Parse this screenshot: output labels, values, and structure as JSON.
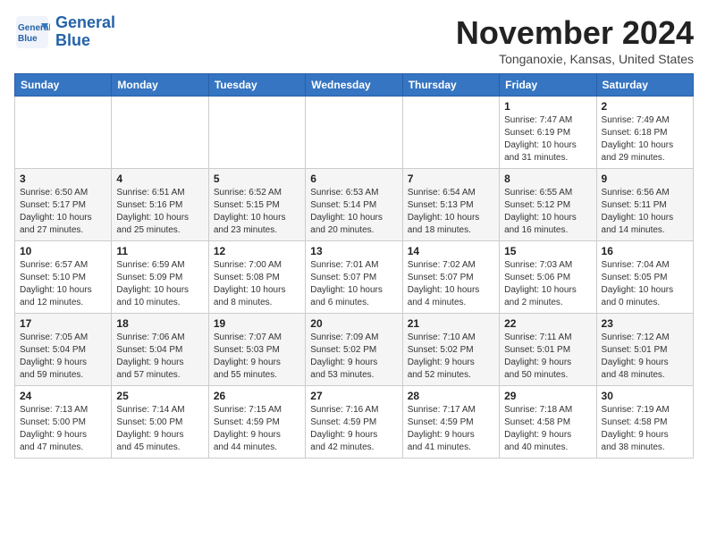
{
  "header": {
    "logo_line1": "General",
    "logo_line2": "Blue",
    "month": "November 2024",
    "location": "Tonganoxie, Kansas, United States"
  },
  "weekdays": [
    "Sunday",
    "Monday",
    "Tuesday",
    "Wednesday",
    "Thursday",
    "Friday",
    "Saturday"
  ],
  "weeks": [
    [
      {
        "day": "",
        "info": ""
      },
      {
        "day": "",
        "info": ""
      },
      {
        "day": "",
        "info": ""
      },
      {
        "day": "",
        "info": ""
      },
      {
        "day": "",
        "info": ""
      },
      {
        "day": "1",
        "info": "Sunrise: 7:47 AM\nSunset: 6:19 PM\nDaylight: 10 hours\nand 31 minutes."
      },
      {
        "day": "2",
        "info": "Sunrise: 7:49 AM\nSunset: 6:18 PM\nDaylight: 10 hours\nand 29 minutes."
      }
    ],
    [
      {
        "day": "3",
        "info": "Sunrise: 6:50 AM\nSunset: 5:17 PM\nDaylight: 10 hours\nand 27 minutes."
      },
      {
        "day": "4",
        "info": "Sunrise: 6:51 AM\nSunset: 5:16 PM\nDaylight: 10 hours\nand 25 minutes."
      },
      {
        "day": "5",
        "info": "Sunrise: 6:52 AM\nSunset: 5:15 PM\nDaylight: 10 hours\nand 23 minutes."
      },
      {
        "day": "6",
        "info": "Sunrise: 6:53 AM\nSunset: 5:14 PM\nDaylight: 10 hours\nand 20 minutes."
      },
      {
        "day": "7",
        "info": "Sunrise: 6:54 AM\nSunset: 5:13 PM\nDaylight: 10 hours\nand 18 minutes."
      },
      {
        "day": "8",
        "info": "Sunrise: 6:55 AM\nSunset: 5:12 PM\nDaylight: 10 hours\nand 16 minutes."
      },
      {
        "day": "9",
        "info": "Sunrise: 6:56 AM\nSunset: 5:11 PM\nDaylight: 10 hours\nand 14 minutes."
      }
    ],
    [
      {
        "day": "10",
        "info": "Sunrise: 6:57 AM\nSunset: 5:10 PM\nDaylight: 10 hours\nand 12 minutes."
      },
      {
        "day": "11",
        "info": "Sunrise: 6:59 AM\nSunset: 5:09 PM\nDaylight: 10 hours\nand 10 minutes."
      },
      {
        "day": "12",
        "info": "Sunrise: 7:00 AM\nSunset: 5:08 PM\nDaylight: 10 hours\nand 8 minutes."
      },
      {
        "day": "13",
        "info": "Sunrise: 7:01 AM\nSunset: 5:07 PM\nDaylight: 10 hours\nand 6 minutes."
      },
      {
        "day": "14",
        "info": "Sunrise: 7:02 AM\nSunset: 5:07 PM\nDaylight: 10 hours\nand 4 minutes."
      },
      {
        "day": "15",
        "info": "Sunrise: 7:03 AM\nSunset: 5:06 PM\nDaylight: 10 hours\nand 2 minutes."
      },
      {
        "day": "16",
        "info": "Sunrise: 7:04 AM\nSunset: 5:05 PM\nDaylight: 10 hours\nand 0 minutes."
      }
    ],
    [
      {
        "day": "17",
        "info": "Sunrise: 7:05 AM\nSunset: 5:04 PM\nDaylight: 9 hours\nand 59 minutes."
      },
      {
        "day": "18",
        "info": "Sunrise: 7:06 AM\nSunset: 5:04 PM\nDaylight: 9 hours\nand 57 minutes."
      },
      {
        "day": "19",
        "info": "Sunrise: 7:07 AM\nSunset: 5:03 PM\nDaylight: 9 hours\nand 55 minutes."
      },
      {
        "day": "20",
        "info": "Sunrise: 7:09 AM\nSunset: 5:02 PM\nDaylight: 9 hours\nand 53 minutes."
      },
      {
        "day": "21",
        "info": "Sunrise: 7:10 AM\nSunset: 5:02 PM\nDaylight: 9 hours\nand 52 minutes."
      },
      {
        "day": "22",
        "info": "Sunrise: 7:11 AM\nSunset: 5:01 PM\nDaylight: 9 hours\nand 50 minutes."
      },
      {
        "day": "23",
        "info": "Sunrise: 7:12 AM\nSunset: 5:01 PM\nDaylight: 9 hours\nand 48 minutes."
      }
    ],
    [
      {
        "day": "24",
        "info": "Sunrise: 7:13 AM\nSunset: 5:00 PM\nDaylight: 9 hours\nand 47 minutes."
      },
      {
        "day": "25",
        "info": "Sunrise: 7:14 AM\nSunset: 5:00 PM\nDaylight: 9 hours\nand 45 minutes."
      },
      {
        "day": "26",
        "info": "Sunrise: 7:15 AM\nSunset: 4:59 PM\nDaylight: 9 hours\nand 44 minutes."
      },
      {
        "day": "27",
        "info": "Sunrise: 7:16 AM\nSunset: 4:59 PM\nDaylight: 9 hours\nand 42 minutes."
      },
      {
        "day": "28",
        "info": "Sunrise: 7:17 AM\nSunset: 4:59 PM\nDaylight: 9 hours\nand 41 minutes."
      },
      {
        "day": "29",
        "info": "Sunrise: 7:18 AM\nSunset: 4:58 PM\nDaylight: 9 hours\nand 40 minutes."
      },
      {
        "day": "30",
        "info": "Sunrise: 7:19 AM\nSunset: 4:58 PM\nDaylight: 9 hours\nand 38 minutes."
      }
    ]
  ]
}
